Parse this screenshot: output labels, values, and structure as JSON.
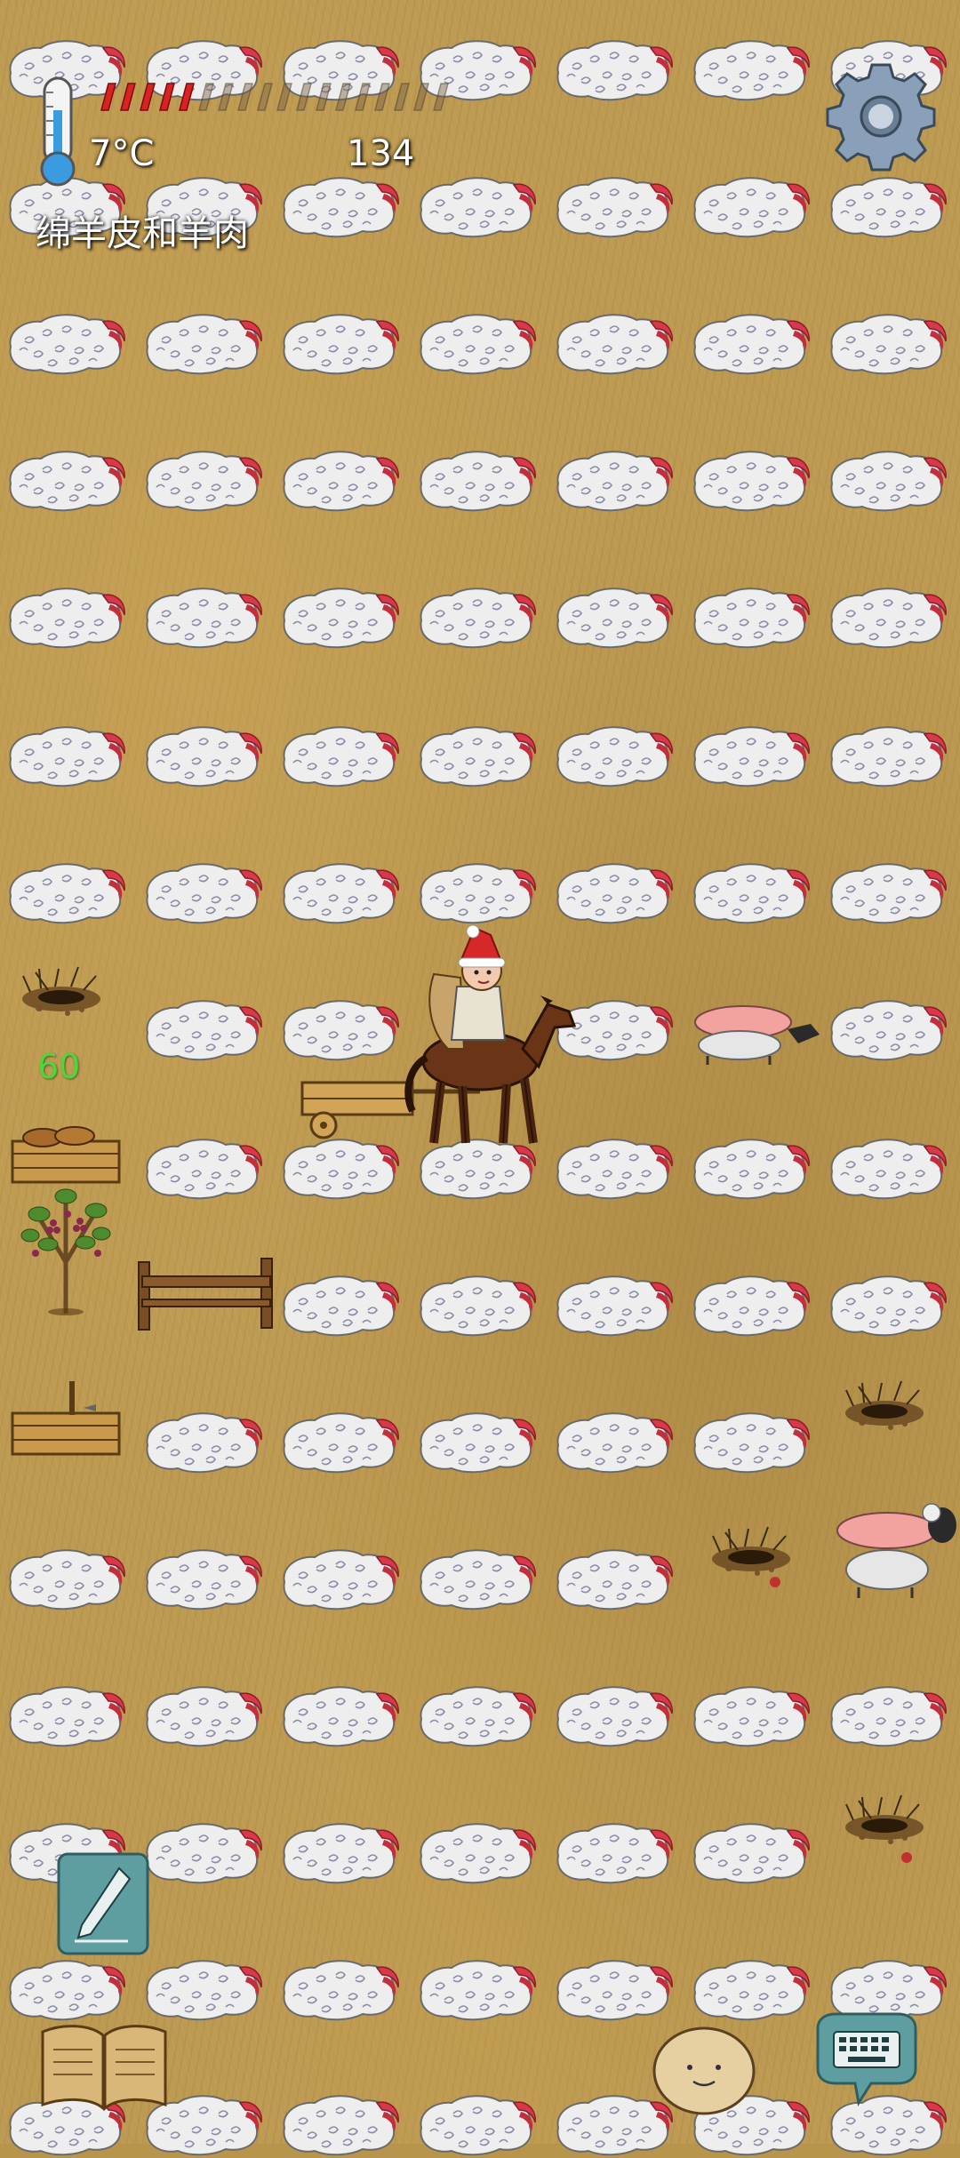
{
  "hud": {
    "temperature": "7°C",
    "age": "134",
    "hover_label": "绵羊皮和羊肉",
    "food_meter": {
      "filled_pips": 5,
      "total_pips": 18
    }
  },
  "world": {
    "player_age_label": "60"
  },
  "icons": {
    "thermometer": "thermometer-icon",
    "settings": "gear-icon",
    "pencil": "pencil-icon",
    "tech_book": "open-book-icon",
    "emote": "potato-face-icon",
    "keyboard": "keyboard-speech-bubble-icon"
  },
  "colors": {
    "ground": "#bd9a52",
    "fleece": "#eeeeee",
    "fleece_flesh": "#d8394a",
    "food_pip_filled": "#d92222",
    "player_age_label": "#4ad93a",
    "temperature_bulb": "#3a9be0"
  }
}
